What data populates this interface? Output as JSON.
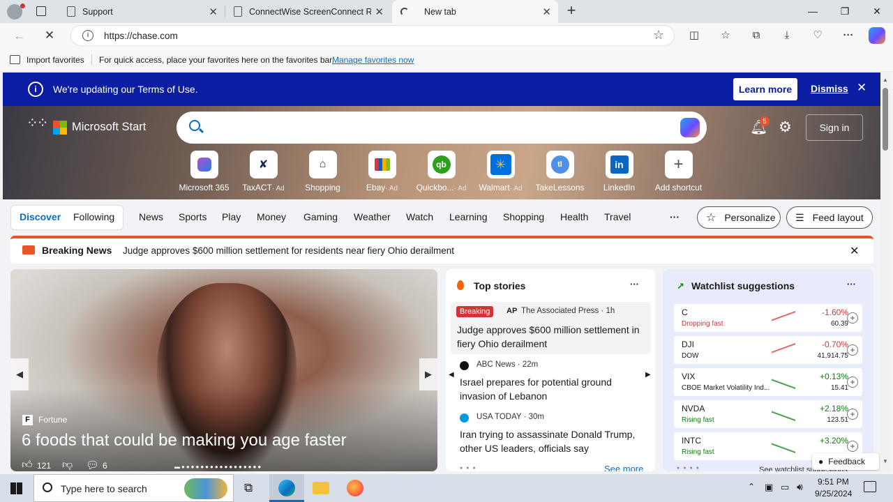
{
  "browser": {
    "tabs": [
      {
        "label": "Support",
        "active": false
      },
      {
        "label": "ConnectWise ScreenConnect Rer",
        "active": false
      },
      {
        "label": "New tab",
        "active": true
      }
    ],
    "new_tab_symbol": "+",
    "url": "https://chase.com"
  },
  "favbar": {
    "import_label": "Import favorites",
    "hint": "For quick access, place your favorites here on the favorites bar.",
    "manage_link": "Manage favorites now"
  },
  "banner": {
    "text": "We're updating our Terms of Use.",
    "learn_more": "Learn more",
    "dismiss": "Dismiss"
  },
  "header": {
    "brand": "Microsoft Start",
    "notification_count": "5",
    "sign_in": "Sign in"
  },
  "shortcuts": [
    {
      "label": "Microsoft 365",
      "ad": ""
    },
    {
      "label": "TaxACT",
      "ad": "· Ad"
    },
    {
      "label": "Shopping",
      "ad": ""
    },
    {
      "label": "Ebay",
      "ad": "· Ad"
    },
    {
      "label": "Quickbo...",
      "ad": "· Ad"
    },
    {
      "label": "Walmart",
      "ad": "· Ad"
    },
    {
      "label": "TakeLessons",
      "ad": ""
    },
    {
      "label": "LinkedIn",
      "ad": ""
    },
    {
      "label": "Add shortcut",
      "ad": ""
    }
  ],
  "nav": {
    "discover": "Discover",
    "following": "Following",
    "items": [
      "News",
      "Sports",
      "Play",
      "Money",
      "Gaming",
      "Weather",
      "Watch",
      "Learning",
      "Shopping",
      "Health",
      "Travel"
    ],
    "more": "···",
    "personalize": "Personalize",
    "feed_layout": "Feed layout"
  },
  "breaking": {
    "label": "Breaking News",
    "headline": "Judge approves $600 million settlement for residents near fiery Ohio derailment"
  },
  "hero_story": {
    "source": "Fortune",
    "title": "6 foods that could be making you age faster",
    "likes": "121",
    "comments": "6"
  },
  "top_stories": {
    "title": "Top stories",
    "items": [
      {
        "badge": "Breaking",
        "source": "The Associated Press · 1h",
        "headline": "Judge approves $600 million settlement in fiery Ohio derailment"
      },
      {
        "badge": "",
        "source": "ABC News · 22m",
        "headline": "Israel prepares for potential ground invasion of Lebanon"
      },
      {
        "badge": "",
        "source": "USA TODAY · 30m",
        "headline": "Iran trying to assassinate Donald Trump, other US leaders, officials say"
      }
    ],
    "see_more": "See more"
  },
  "watchlist": {
    "title": "Watchlist suggestions",
    "items": [
      {
        "symbol": "C",
        "sub": "Dropping fast",
        "change": "-1.60%",
        "price": "60.39",
        "up": false
      },
      {
        "symbol": "DJI",
        "sub": "DOW",
        "change": "-0.70%",
        "price": "41,914.75",
        "up": false
      },
      {
        "symbol": "VIX",
        "sub": "CBOE Market Volatility Ind...",
        "change": "+0.13%",
        "price": "15.41",
        "up": true
      },
      {
        "symbol": "NVDA",
        "sub": "Rising fast",
        "change": "+2.18%",
        "price": "123.51",
        "up": true
      },
      {
        "symbol": "INTC",
        "sub": "Rising fast",
        "change": "+3.20%",
        "price": "",
        "up": true
      }
    ],
    "see_watchlist": "See watchlist suggestions",
    "feedback": "Feedback"
  },
  "taskbar": {
    "search_placeholder": "Type here to search",
    "time": "9:51 PM",
    "date": "9/25/2024"
  },
  "colors": {
    "banner": "#0b1ea3",
    "accent": "#0f6cbd",
    "down": "#d13438",
    "up": "#107c10",
    "breaking_red": "#e8542a"
  }
}
